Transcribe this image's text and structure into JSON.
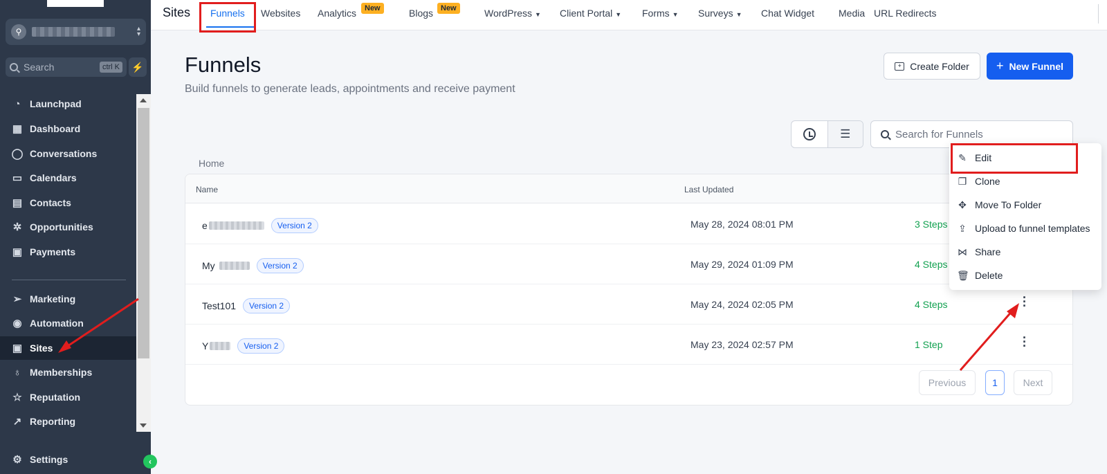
{
  "sidebar": {
    "search_placeholder": "Search",
    "search_shortcut": "ctrl K",
    "items": [
      {
        "label": "Launchpad",
        "icon": "launchpad-icon"
      },
      {
        "label": "Dashboard",
        "icon": "dashboard-icon"
      },
      {
        "label": "Conversations",
        "icon": "chat-icon"
      },
      {
        "label": "Calendars",
        "icon": "calendar-icon"
      },
      {
        "label": "Contacts",
        "icon": "contacts-icon"
      },
      {
        "label": "Opportunities",
        "icon": "opportunities-icon"
      },
      {
        "label": "Payments",
        "icon": "payments-icon"
      },
      {
        "label": "Marketing",
        "icon": "send-icon"
      },
      {
        "label": "Automation",
        "icon": "automation-icon"
      },
      {
        "label": "Sites",
        "icon": "sites-icon"
      },
      {
        "label": "Memberships",
        "icon": "memberships-icon"
      },
      {
        "label": "Reputation",
        "icon": "star-icon"
      },
      {
        "label": "Reporting",
        "icon": "trend-icon"
      },
      {
        "label": "Settings",
        "icon": "gear-icon"
      }
    ],
    "active_item": "Sites"
  },
  "topnav": {
    "title": "Sites",
    "tabs": [
      "Funnels",
      "Websites",
      "Analytics",
      "Blogs",
      "WordPress",
      "Client Portal",
      "Forms",
      "Surveys",
      "Chat Widget",
      "Media",
      "URL Redirects"
    ],
    "new_badge": "New",
    "active_tab": "Funnels"
  },
  "page": {
    "title": "Funnels",
    "subtitle": "Build funnels to generate leads, appointments and receive payment",
    "create_folder_label": "Create Folder",
    "new_funnel_label": "New Funnel",
    "search_placeholder": "Search for Funnels",
    "breadcrumb": "Home"
  },
  "table": {
    "columns": [
      "Name",
      "Last Updated"
    ],
    "rows": [
      {
        "name": "e",
        "version": "Version 2",
        "updated": "May 28, 2024 08:01 PM",
        "steps": "3 Steps"
      },
      {
        "name": "My",
        "version": "Version 2",
        "updated": "May 29, 2024 01:09 PM",
        "steps": "4 Steps"
      },
      {
        "name": "Test101",
        "version": "Version 2",
        "updated": "May 24, 2024 02:05 PM",
        "steps": "4 Steps"
      },
      {
        "name": "Y",
        "version": "Version 2",
        "updated": "May 23, 2024 02:57 PM",
        "steps": "1 Step"
      }
    ]
  },
  "pagination": {
    "previous": "Previous",
    "current": "1",
    "next": "Next"
  },
  "context_menu": {
    "items": [
      {
        "label": "Edit",
        "icon": "pencil-icon"
      },
      {
        "label": "Clone",
        "icon": "copy-icon"
      },
      {
        "label": "Move To Folder",
        "icon": "move-icon"
      },
      {
        "label": "Upload to funnel templates",
        "icon": "upload-icon"
      },
      {
        "label": "Share",
        "icon": "share-icon"
      },
      {
        "label": "Delete",
        "icon": "trash-icon"
      }
    ]
  },
  "colors": {
    "primary": "#155eef",
    "sidebar": "#2d3849",
    "steps_green": "#12a150",
    "annotation_red": "#e11d1d",
    "badge_yellow": "#fdb022"
  }
}
